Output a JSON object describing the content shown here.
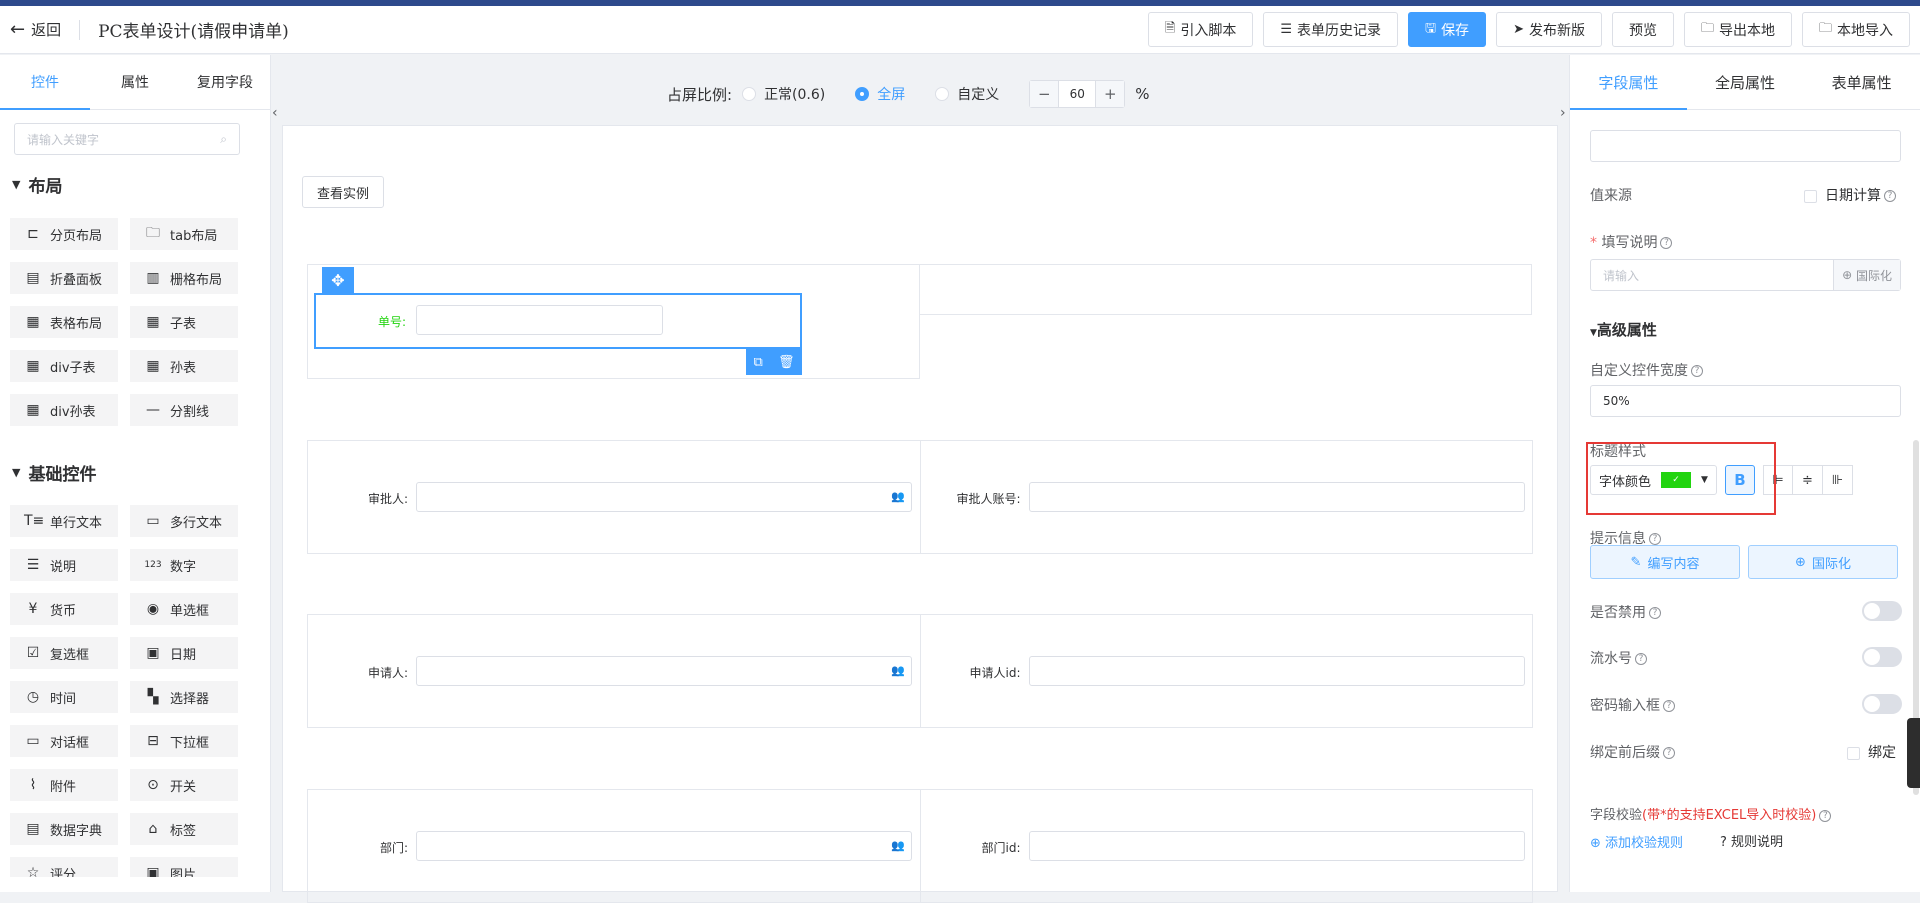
{
  "header": {
    "back_label": "返回",
    "title": "PC表单设计(请假申请单)",
    "buttons": {
      "import_script": "引入脚本",
      "history": "表单历史记录",
      "save": "保存",
      "publish": "发布新版",
      "preview": "预览",
      "export_local": "导出本地",
      "import_local": "本地导入"
    }
  },
  "left_panel": {
    "tabs": [
      "控件",
      "属性",
      "复用字段"
    ],
    "active_tab": "控件",
    "search_placeholder": "请输入关键字",
    "layout_section": {
      "title": "布局",
      "items": [
        {
          "label": "分页布局",
          "icon": "page-layout-icon"
        },
        {
          "label": "tab布局",
          "icon": "folder-tab-icon"
        },
        {
          "label": "折叠面板",
          "icon": "collapse-panel-icon"
        },
        {
          "label": "栅格布局",
          "icon": "column-grid-icon"
        },
        {
          "label": "表格布局",
          "icon": "table-icon"
        },
        {
          "label": "子表",
          "icon": "table-icon"
        },
        {
          "label": "div子表",
          "icon": "table-icon"
        },
        {
          "label": "孙表",
          "icon": "table-icon"
        },
        {
          "label": "div孙表",
          "icon": "table-icon"
        },
        {
          "label": "分割线",
          "icon": "divider-line-icon"
        }
      ]
    },
    "basic_section": {
      "title": "基础控件",
      "items": [
        {
          "label": "单行文本",
          "icon": "text-icon"
        },
        {
          "label": "多行文本",
          "icon": "textarea-icon"
        },
        {
          "label": "说明",
          "icon": "description-icon"
        },
        {
          "label": "数字",
          "icon": "number-icon"
        },
        {
          "label": "货币",
          "icon": "currency-icon"
        },
        {
          "label": "单选框",
          "icon": "radio-icon"
        },
        {
          "label": "复选框",
          "icon": "checkbox-icon"
        },
        {
          "label": "日期",
          "icon": "calendar-icon"
        },
        {
          "label": "时间",
          "icon": "clock-icon"
        },
        {
          "label": "选择器",
          "icon": "selector-icon"
        },
        {
          "label": "对话框",
          "icon": "dialog-icon"
        },
        {
          "label": "下拉框",
          "icon": "dropdown-icon"
        },
        {
          "label": "附件",
          "icon": "paperclip-icon"
        },
        {
          "label": "开关",
          "icon": "switch-icon"
        },
        {
          "label": "数据字典",
          "icon": "dictionary-icon"
        },
        {
          "label": "标签",
          "icon": "tag-icon"
        },
        {
          "label": "评分",
          "icon": "star-icon"
        },
        {
          "label": "图片",
          "icon": "image-icon"
        }
      ]
    }
  },
  "center": {
    "ratio_label": "占屏比例:",
    "ratio_options": [
      "正常(0.6)",
      "全屏",
      "自定义"
    ],
    "ratio_selected": "全屏",
    "custom_value": "60",
    "percent": "%",
    "demo_button": "查看实例",
    "fields": {
      "order_no": "单号:",
      "approver": "审批人:",
      "approver_account": "审批人账号:",
      "applicant": "申请人:",
      "applicant_id": "申请人id:",
      "department": "部门:",
      "department_id": "部门id:"
    }
  },
  "right_panel": {
    "tabs": [
      "字段属性",
      "全局属性",
      "表单属性"
    ],
    "active_tab": "字段属性",
    "value_source": "值来源",
    "date_calc": "日期计算",
    "fill_desc_star": "*",
    "fill_desc": "填写说明",
    "fill_placeholder": "请输入",
    "i18n": "国际化",
    "advanced": "高级属性",
    "custom_width_label": "自定义控件宽度",
    "custom_width_value": "50%",
    "title_style": "标题样式",
    "font_color": "字体颜色",
    "font_color_value": "#22d40f",
    "bold": "B",
    "hint_info": "提示信息",
    "edit_content": "编写内容",
    "i18n_button": "国际化",
    "disabled": "是否禁用",
    "serial_no": "流水号",
    "password_input": "密码输入框",
    "bind_prefix": "绑定前后缀",
    "bind": "绑定",
    "field_validation": "字段校验",
    "validation_note": "(带*的支持EXCEL导入时校验)",
    "add_rule": "添加校验规则",
    "rule_desc": "规则说明"
  }
}
